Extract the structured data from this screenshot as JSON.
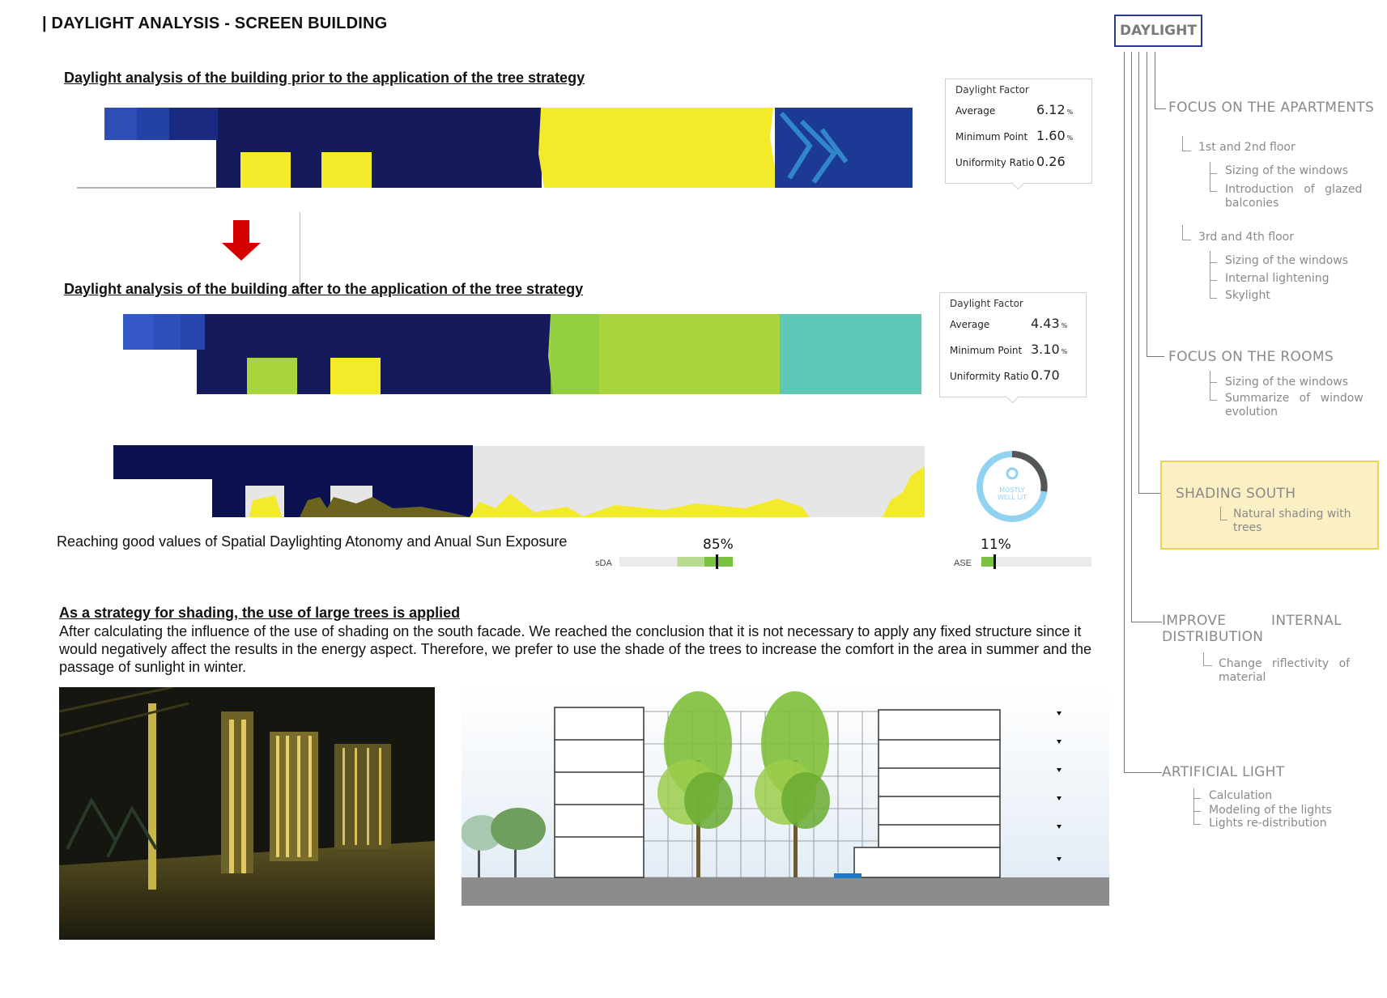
{
  "page_title": "| DAYLIGHT ANALYSIS - SCREEN BUILDING",
  "section_before": {
    "heading": "Daylight analysis of the building prior to the application of the tree strategy"
  },
  "section_after": {
    "heading": "Daylight analysis of the building after to the application of the tree strategy"
  },
  "df_before": {
    "header": "Daylight Factor",
    "rows": [
      {
        "label": "Average",
        "value": "6.12",
        "unit": "%"
      },
      {
        "label": "Minimum Point",
        "value": "1.60",
        "unit": "%"
      },
      {
        "label": "Uniformity Ratio",
        "value": "0.26",
        "unit": ""
      }
    ]
  },
  "df_after": {
    "header": "Daylight Factor",
    "rows": [
      {
        "label": "Average",
        "value": "4.43",
        "unit": "%"
      },
      {
        "label": "Minimum Point",
        "value": "3.10",
        "unit": "%"
      },
      {
        "label": "Uniformity Ratio",
        "value": "0.70",
        "unit": ""
      }
    ]
  },
  "gauge": {
    "text_line1": "MOSTLY",
    "text_line2": "WELL LIT"
  },
  "metrics": {
    "caption": "Reaching good values of Spatial Daylighting Atonomy and Anual Sun Exposure",
    "sda": {
      "label": "sDA",
      "value": "85%",
      "fraction": 0.85
    },
    "ase": {
      "label": "ASE",
      "value": "11%",
      "fraction": 0.11
    }
  },
  "strategy": {
    "heading": "As a strategy for shading, the use of large trees is applied",
    "body": "After calculating the influence of the use of shading on the south facade. We reached the conclusion that it is not necessary to apply any fixed structure since it would negatively affect the results in the energy aspect. Therefore, we prefer to use the shade of the trees to increase the comfort in the area in summer and the passage of sunlight in winter."
  },
  "tree": {
    "root": "DAYLIGHT",
    "apartments": {
      "title": "FOCUS ON THE APARTMENTS",
      "floor12": {
        "title": "1st and 2nd floor",
        "items": [
          "Sizing of the windows",
          "Introduction of glazed balconies"
        ]
      },
      "floor34": {
        "title": "3rd and 4th floor",
        "items": [
          "Sizing of the windows",
          "Internal lightening",
          "Skylight"
        ]
      }
    },
    "rooms": {
      "title": "FOCUS ON THE ROOMS",
      "items": [
        "Sizing of the windows",
        "Summarize of window evolution"
      ]
    },
    "shading": {
      "title": "SHADING SOUTH",
      "items": [
        "Natural shading with trees"
      ]
    },
    "distribution": {
      "title": "IMPROVE INTERNAL DISTRIBUTION",
      "items": [
        "Change riflectivity of material"
      ]
    },
    "artificial": {
      "title": "ARTIFICIAL LIGHT",
      "items": [
        "Calculation",
        "Modeling of the lights",
        "Lights re-distribution"
      ]
    }
  },
  "colors": {
    "navy": "#141a5c",
    "mid_blue": "#2e4db5",
    "yellow": "#f3ea2a",
    "lime": "#a9d53c",
    "teal": "#5ec7b5",
    "highlight": "#fbf0c4",
    "highlight_border": "#f0cf5a",
    "arrow_red": "#d40000",
    "sda_green": "#7cc242",
    "gauge_blue": "#8fd3f0"
  }
}
